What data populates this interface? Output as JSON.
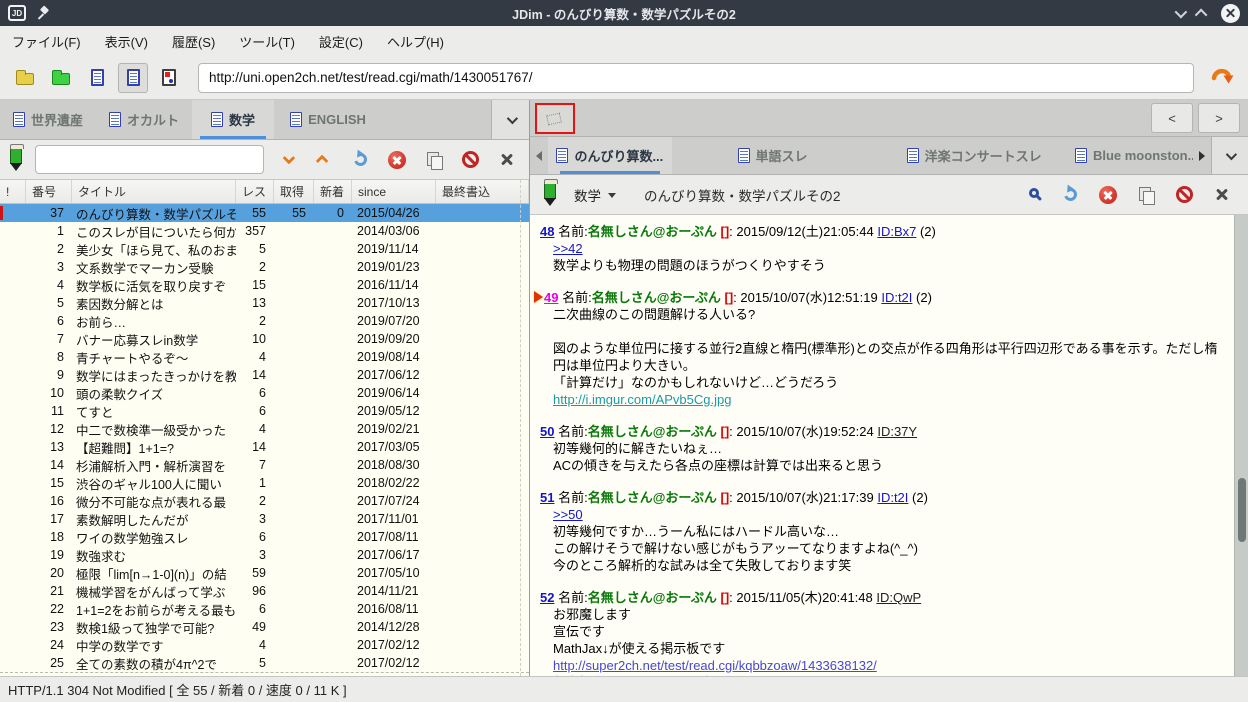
{
  "window": {
    "title": "JDim - のんびり算数・数学パズルその2"
  },
  "menu": {
    "items": [
      "ファイル(F)",
      "表示(V)",
      "履歴(S)",
      "ツール(T)",
      "設定(C)",
      "ヘルプ(H)"
    ]
  },
  "toolbar": {
    "url": "http://uni.open2ch.net/test/read.cgi/math/1430051767/"
  },
  "board_tabs": {
    "items": [
      {
        "label": "世界遺産",
        "active": false
      },
      {
        "label": "オカルト",
        "active": false
      },
      {
        "label": "数学",
        "active": true
      },
      {
        "label": "ENGLISH",
        "active": false
      }
    ]
  },
  "board_search": {
    "value": ""
  },
  "board_panel": {
    "columns": [
      "!",
      "番号",
      "タイトル",
      "レス",
      "取得",
      "新着",
      "since",
      "最終書込"
    ],
    "rows": [
      {
        "selected": true,
        "num": "37",
        "title": "のんびり算数・数学パズルその2",
        "res": "55",
        "got": "55",
        "new": "0",
        "since": "2015/04/26",
        "last": ""
      },
      {
        "num": "1",
        "title": "このスレが目についたら何か",
        "res": "357",
        "got": "",
        "new": "",
        "since": "2014/03/06",
        "last": ""
      },
      {
        "num": "2",
        "title": "美少女「ほら見て、私のおま",
        "res": "5",
        "got": "",
        "new": "",
        "since": "2019/11/14",
        "last": ""
      },
      {
        "num": "3",
        "title": "文系数学でマーカン受験",
        "res": "2",
        "got": "",
        "new": "",
        "since": "2019/01/23",
        "last": ""
      },
      {
        "num": "4",
        "title": "数学板に活気を取り戻すぞ",
        "res": "15",
        "got": "",
        "new": "",
        "since": "2016/11/14",
        "last": ""
      },
      {
        "num": "5",
        "title": "素因数分解とは",
        "res": "13",
        "got": "",
        "new": "",
        "since": "2017/10/13",
        "last": ""
      },
      {
        "num": "6",
        "title": "お前ら…",
        "res": "2",
        "got": "",
        "new": "",
        "since": "2019/07/20",
        "last": ""
      },
      {
        "num": "7",
        "title": "バナー応募スレin数学",
        "res": "10",
        "got": "",
        "new": "",
        "since": "2019/09/20",
        "last": ""
      },
      {
        "num": "8",
        "title": "青チャートやるぞ〜",
        "res": "4",
        "got": "",
        "new": "",
        "since": "2019/08/14",
        "last": ""
      },
      {
        "num": "9",
        "title": "数学にはまったきっかけを教",
        "res": "14",
        "got": "",
        "new": "",
        "since": "2017/06/12",
        "last": ""
      },
      {
        "num": "10",
        "title": "頭の柔軟クイズ",
        "res": "6",
        "got": "",
        "new": "",
        "since": "2019/06/14",
        "last": ""
      },
      {
        "num": "11",
        "title": "てすと",
        "res": "6",
        "got": "",
        "new": "",
        "since": "2019/05/12",
        "last": ""
      },
      {
        "num": "12",
        "title": "中二で数検準一級受かった",
        "res": "4",
        "got": "",
        "new": "",
        "since": "2019/02/21",
        "last": ""
      },
      {
        "num": "13",
        "title": "【超難問】1+1=?",
        "res": "14",
        "got": "",
        "new": "",
        "since": "2017/03/05",
        "last": ""
      },
      {
        "num": "14",
        "title": "杉浦解析入門・解析演習を",
        "res": "7",
        "got": "",
        "new": "",
        "since": "2018/08/30",
        "last": ""
      },
      {
        "num": "15",
        "title": "渋谷のギャル100人に聞い",
        "res": "1",
        "got": "",
        "new": "",
        "since": "2018/02/22",
        "last": ""
      },
      {
        "num": "16",
        "title": "微分不可能な点が表れる最",
        "res": "2",
        "got": "",
        "new": "",
        "since": "2017/07/24",
        "last": ""
      },
      {
        "num": "17",
        "title": "素数解明したんだが",
        "res": "3",
        "got": "",
        "new": "",
        "since": "2017/11/01",
        "last": ""
      },
      {
        "num": "18",
        "title": "ワイの数学勉強スレ",
        "res": "6",
        "got": "",
        "new": "",
        "since": "2017/08/11",
        "last": ""
      },
      {
        "num": "19",
        "title": "数強求む",
        "res": "3",
        "got": "",
        "new": "",
        "since": "2017/06/17",
        "last": ""
      },
      {
        "num": "20",
        "title": "極限「lim[n→1-0](n)」の結",
        "res": "59",
        "got": "",
        "new": "",
        "since": "2017/05/10",
        "last": ""
      },
      {
        "num": "21",
        "title": "機械学習をがんばって学ぶ",
        "res": "96",
        "got": "",
        "new": "",
        "since": "2014/11/21",
        "last": ""
      },
      {
        "num": "22",
        "title": "1+1=2をお前らが考える最も",
        "res": "6",
        "got": "",
        "new": "",
        "since": "2016/08/11",
        "last": ""
      },
      {
        "num": "23",
        "title": "数検1級って独学で可能?",
        "res": "49",
        "got": "",
        "new": "",
        "since": "2014/12/28",
        "last": ""
      },
      {
        "num": "24",
        "title": "中学の数学です",
        "res": "4",
        "got": "",
        "new": "",
        "since": "2017/02/12",
        "last": ""
      },
      {
        "num": "25",
        "title": "全ての素数の積が4π^2で",
        "res": "5",
        "got": "",
        "new": "",
        "since": "2017/02/12",
        "last": ""
      }
    ]
  },
  "thread_tabs": {
    "items": [
      {
        "label": "のんびり算数...",
        "active": true
      },
      {
        "label": "単語スレ",
        "active": false
      },
      {
        "label": "洋楽コンサートスレ",
        "active": false
      },
      {
        "label": "Blue moonston...",
        "active": false
      }
    ]
  },
  "image_bar": {
    "nav_prev": "<",
    "nav_next": ">"
  },
  "thread_toolbar": {
    "board_select": "数学",
    "title": "のんびり算数・数学パズルその2"
  },
  "posts": [
    {
      "num": "48",
      "read": false,
      "marker": false,
      "name": "名無しさん@おーぷん",
      "mail": "[]",
      "date": "2015/09/12(土)21:05:44",
      "id": "ID:Bx7",
      "id_link": true,
      "count": "(2)",
      "lines": [
        {
          "type": "anchor",
          "text": ">>42"
        },
        {
          "type": "text",
          "text": "数学よりも物理の問題のほうがつくりやすそう"
        }
      ]
    },
    {
      "num": "49",
      "read": true,
      "marker": true,
      "name": "名無しさん@おーぷん",
      "mail": "[]",
      "date": "2015/10/07(水)12:51:19",
      "id": "ID:t2I",
      "id_link": true,
      "count": "(2)",
      "lines": [
        {
          "type": "text",
          "text": "二次曲線のこの問題解ける人いる?"
        },
        {
          "type": "blank"
        },
        {
          "type": "text",
          "text": "図のような単位円に接する並行2直線と楕円(標準形)との交点が作る四角形は平行四辺形である事を示す。ただし楕円は単位円より大きい。"
        },
        {
          "type": "text",
          "text": "「計算だけ」なのかもしれないけど…どうだろう"
        },
        {
          "type": "link_visited",
          "text": "http://i.imgur.com/APvb5Cg.jpg"
        }
      ]
    },
    {
      "num": "50",
      "read": false,
      "marker": false,
      "name": "名無しさん@おーぷん",
      "mail": "[]",
      "date": "2015/10/07(水)19:52:24",
      "id": "ID:37Y",
      "id_link": false,
      "count": "",
      "lines": [
        {
          "type": "text",
          "text": "初等幾何的に解きたいねぇ…"
        },
        {
          "type": "text",
          "text": "ACの傾きを与えたら各点の座標は計算では出来ると思う"
        }
      ]
    },
    {
      "num": "51",
      "read": false,
      "marker": false,
      "name": "名無しさん@おーぷん",
      "mail": "[]",
      "date": "2015/10/07(水)21:17:39",
      "id": "ID:t2I",
      "id_link": true,
      "count": "(2)",
      "lines": [
        {
          "type": "anchor",
          "text": ">>50"
        },
        {
          "type": "text",
          "text": "初等幾何ですか…うーん私にはハードル高いな…"
        },
        {
          "type": "text",
          "text": "この解けそうで解けない感じがもうアッーてなりますよね(^_^)"
        },
        {
          "type": "text",
          "text": "今のところ解析的な試みは全て失敗しております笑"
        }
      ]
    },
    {
      "num": "52",
      "read": false,
      "marker": false,
      "name": "名無しさん@おーぷん",
      "mail": "[]",
      "date": "2015/11/05(木)20:41:48",
      "id": "ID:QwP",
      "id_link": false,
      "count": "",
      "lines": [
        {
          "type": "text",
          "text": "お邪魔します"
        },
        {
          "type": "text",
          "text": "宣伝です"
        },
        {
          "type": "text",
          "text": "MathJax↓が使える掲示板です"
        },
        {
          "type": "link",
          "text": "http://super2ch.net/test/read.cgi/kqbbzoaw/1433638132/"
        },
        {
          "type": "clipped",
          "text": "数学板専用にカスタマイズしました"
        }
      ]
    }
  ],
  "statusbar": {
    "text": "HTTP/1.1 304 Not Modified [ 全 55 / 新着 0 / 速度 0 / 11 K ]"
  },
  "colors": {
    "titlebar": "#343a43",
    "selection_blue": "#57a0de",
    "tab_accent": "#4b90d8",
    "author_green": "#087808",
    "link_blue": "#1414cc",
    "read_magenta": "#e800e8",
    "mail_red": "#e00000",
    "visited_link_teal": "#1a9aa8",
    "list_background": "#fffef2"
  }
}
